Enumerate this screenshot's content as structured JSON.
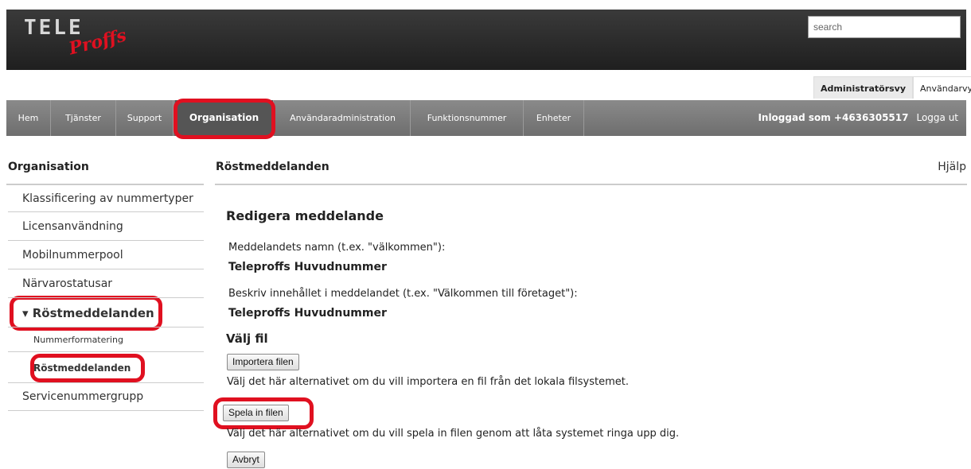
{
  "header": {
    "logo_top": "TELE",
    "logo_bottom": "Proffs",
    "search_placeholder": "search"
  },
  "view_tabs": [
    {
      "label": "Administratörsvy",
      "active": true
    },
    {
      "label": "Användarvy",
      "active": false
    }
  ],
  "nav": {
    "items": [
      {
        "label": "Hem"
      },
      {
        "label": "Tjänster"
      },
      {
        "label": "Support"
      },
      {
        "label": "Organisation",
        "active": true
      },
      {
        "label": "Användaradministration"
      },
      {
        "label": "Funktionsnummer"
      },
      {
        "label": "Enheter"
      }
    ],
    "logged_in": "Inloggad som +4636305517",
    "logout": "Logga ut"
  },
  "sidebar": {
    "title": "Organisation",
    "items": [
      {
        "label": "Klassificering av nummertyper"
      },
      {
        "label": "Licensanvändning"
      },
      {
        "label": "Mobilnummerpool"
      },
      {
        "label": "Närvarostatusar"
      },
      {
        "label": "▾ Röstmeddelanden",
        "expanded": true
      },
      {
        "label": "Nummerformatering"
      },
      {
        "label": "Röstmeddelanden",
        "selected": true
      },
      {
        "label": "Servicenummergrupp"
      }
    ]
  },
  "main": {
    "title": "Röstmeddelanden",
    "help": "Hjälp",
    "heading": "Redigera meddelande",
    "name_label": "Meddelandets namn (t.ex. \"välkommen\"):",
    "name_value": "Teleproffs Huvudnummer",
    "desc_label": "Beskriv innehållet i meddelandet (t.ex. \"Välkommen till företaget\"):",
    "desc_value": "Teleproffs Huvudnummer",
    "file_heading": "Välj fil",
    "import_button": "Importera filen",
    "import_text": "Välj det här alternativet om du vill importera en fil från det lokala filsystemet.",
    "record_button": "Spela in filen",
    "record_text": "Välj det här alternativet om du vill spela in filen genom att låta systemet ringa upp dig.",
    "cancel_button": "Avbryt"
  },
  "colors": {
    "highlight": "#e01020",
    "nav_bg": "#7a7a7a",
    "header_bg": "#2a2a2a"
  }
}
